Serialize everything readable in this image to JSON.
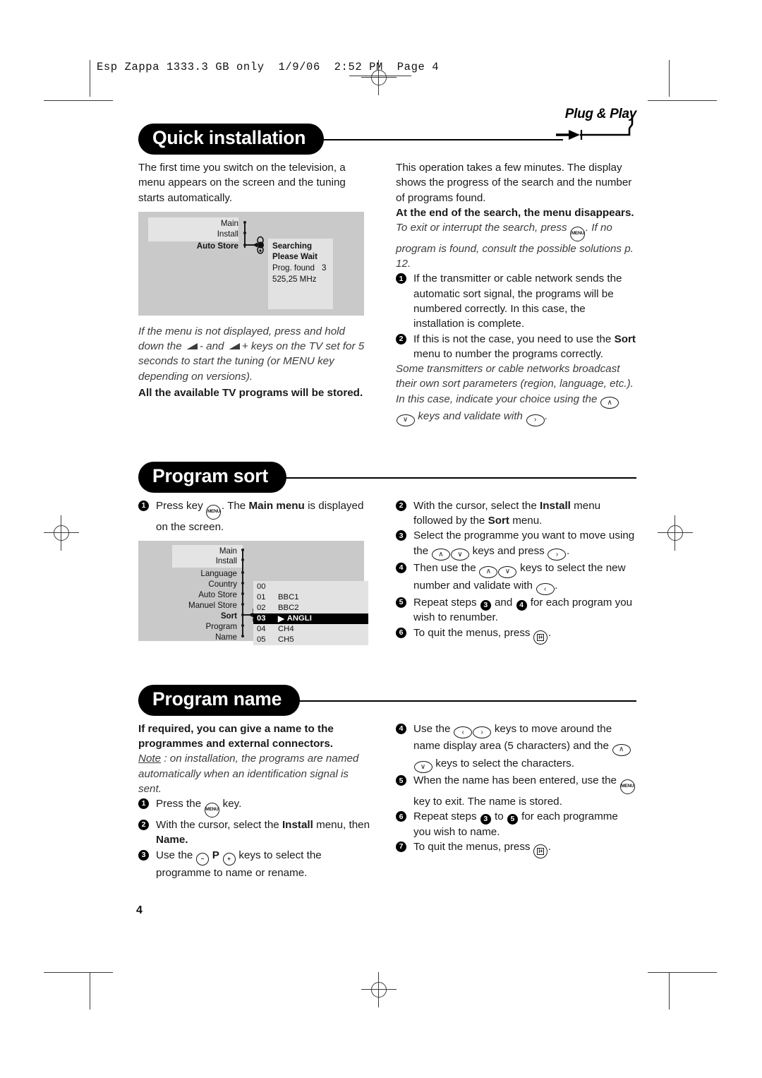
{
  "header": {
    "print_line": "Esp Zappa 1333.3 GB only  1/9/06  2:52 PM  Page 4"
  },
  "page_number": "4",
  "sections": [
    {
      "id": "quick-installation",
      "title": "Quick installation",
      "logo": "Plug & Play",
      "left": {
        "intro": "The first time you switch on the television, a menu appears on the screen and the tuning starts automatically.",
        "note_a": "If the menu is not displayed, press and hold down the",
        "note_b": "- and",
        "note_c": "+ keys on the TV set for 5 seconds to start the tuning (or MENU key depending on versions).",
        "bold_line": "All the available TV programs will be stored."
      },
      "right": {
        "p1": "This operation takes a few minutes. The display shows the progress of the search and the number of programs found.",
        "p2_bold": "At the end of the search, the menu disappears.",
        "p3_a": "To exit or interrupt the search, press",
        "p3_b": ". If no program is found, consult the possible solutions p. 12.",
        "steps": [
          {
            "num": "1",
            "text": "If the transmitter or cable network sends the automatic sort signal, the programs will be numbered correctly. In this case, the installation is complete."
          },
          {
            "num": "2",
            "pre": "If this is not the case, you need to use the ",
            "bold": "Sort",
            "post": " menu to number the programs correctly."
          }
        ],
        "note_a": "Some transmitters or cable networks broadcast their own sort parameters (region, language, etc.). In this case, indicate your choice using the",
        "note_b": "keys and validate with",
        "note_c": "."
      },
      "diagram": {
        "tree": [
          "Main",
          "Install",
          "Auto Store"
        ],
        "panel": {
          "line1": "Searching",
          "line2": "Please Wait",
          "line3": "Prog. found",
          "line3_value": "3",
          "line4": "525,25 MHz"
        }
      }
    },
    {
      "id": "program-sort",
      "title": "Program sort",
      "left": {
        "step1_a": "Press key",
        "step1_b": ". The",
        "step1_bold": "Main menu",
        "step1_c": "is displayed on the screen."
      },
      "right": {
        "steps": [
          {
            "num": "2",
            "pre": "With the cursor, select the ",
            "bold": "Install",
            "mid": " menu followed by the ",
            "bold2": "Sort",
            "post": " menu."
          },
          {
            "num": "3",
            "pre": "Select the programme you want to move using the ",
            "post": " keys and press "
          },
          {
            "num": "4",
            "pre": "Then use the ",
            "post": " keys to select the new number and validate with "
          },
          {
            "num": "5",
            "pre": "Repeat steps ",
            "mid": " and ",
            "post": " for each program you wish to renumber."
          },
          {
            "num": "6",
            "pre": "To quit the menus, press "
          }
        ]
      },
      "diagram": {
        "tree": [
          "Main",
          "Install",
          "Language",
          "Country",
          "Auto Store",
          "Manuel Store",
          "Sort",
          "Program",
          "Name"
        ],
        "bold_item": "Sort",
        "programs": [
          {
            "num": "00",
            "name": "",
            "selected": false
          },
          {
            "num": "01",
            "name": "BBC1",
            "selected": false
          },
          {
            "num": "02",
            "name": "BBC2",
            "selected": false
          },
          {
            "num": "03",
            "name": "ANGLI",
            "selected": true
          },
          {
            "num": "04",
            "name": "CH4",
            "selected": false
          },
          {
            "num": "05",
            "name": "CH5",
            "selected": false
          }
        ]
      }
    },
    {
      "id": "program-name",
      "title": "Program name",
      "left": {
        "intro_bold": "If required, you can give a name to the programmes and external connectors.",
        "note_label": "Note",
        "note_text": " : on installation, the programs are named automatically when an identification signal is sent.",
        "steps": [
          {
            "num": "1",
            "pre": "Press the ",
            "post": " key."
          },
          {
            "num": "2",
            "pre": "With the cursor, select the ",
            "bold": "Install",
            "mid": " menu, then ",
            "bold2": "Name."
          },
          {
            "num": "3",
            "pre": "Use the ",
            "mid": "P",
            "post": " keys to select the programme to name or rename."
          }
        ]
      },
      "right": {
        "steps": [
          {
            "num": "4",
            "pre": "Use the ",
            "mid": " keys to move around the name display area (5 characters) and the ",
            "post": " keys to select the characters."
          },
          {
            "num": "5",
            "pre": "When the name has been entered, use the ",
            "post": " key to exit. The name is stored."
          },
          {
            "num": "6",
            "pre": "Repeat steps ",
            "mid": " to ",
            "post": " for each programme you wish to name."
          },
          {
            "num": "7",
            "pre": "To quit the menus, press "
          }
        ]
      }
    }
  ],
  "icons": {
    "up": "∧",
    "down": "∨",
    "left": "‹",
    "right": "›",
    "menu": "MENU",
    "info": "i",
    "plus": "+",
    "minus": "−"
  }
}
